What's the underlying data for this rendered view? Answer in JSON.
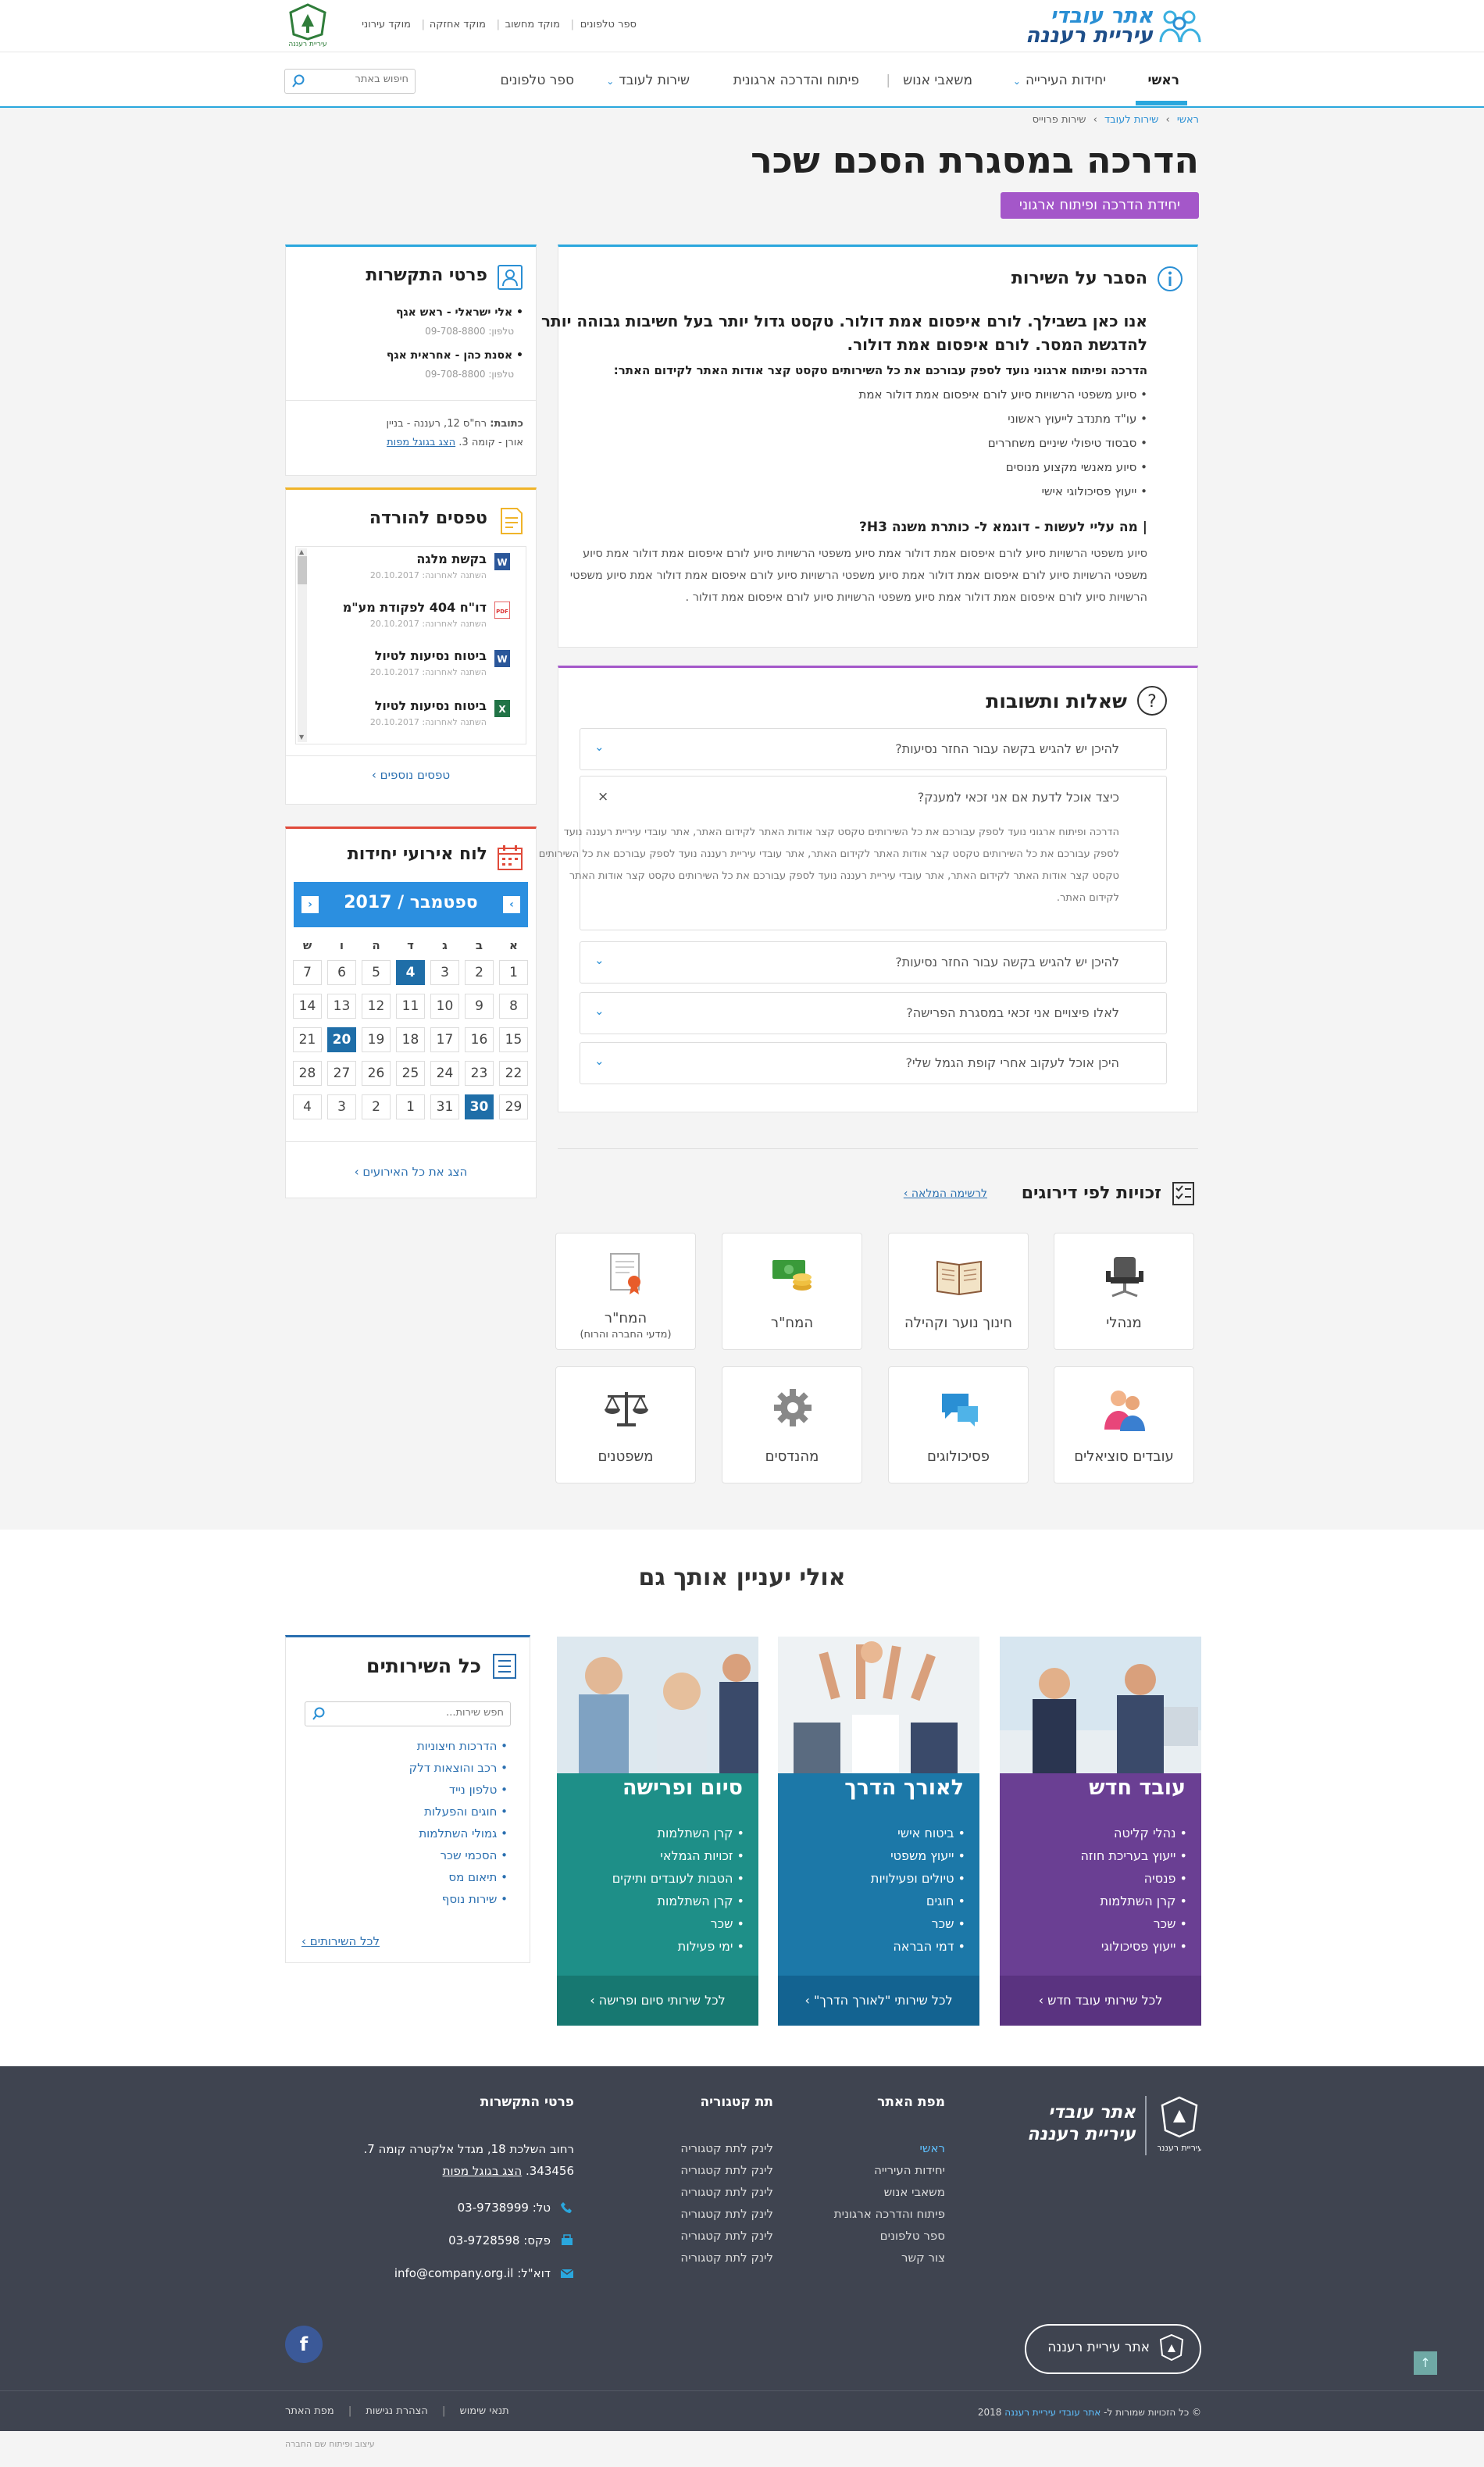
{
  "header": {
    "logo_line1": "אתר עובדי",
    "logo_line2": "עיריית רעננה",
    "city_logo_text": "עיריית רעננה",
    "util_links": [
      "ספר טלפונים",
      "מוקד מחשוב",
      "מוקד אחזקה",
      "מוקד עירוני"
    ],
    "search_placeholder": "חיפוש באתר"
  },
  "nav": {
    "items": [
      {
        "label": "ראשי",
        "active": true,
        "dropdown": false
      },
      {
        "label": "יחידות העירייה",
        "active": false,
        "dropdown": true
      },
      {
        "label": "משאבי אנוש",
        "active": false,
        "dropdown": false
      },
      {
        "label": "פיתוח והדרכה ארגונית",
        "active": false,
        "dropdown": false
      },
      {
        "label": "שירות לעובד",
        "active": false,
        "dropdown": true
      },
      {
        "label": "ספר טלפונים",
        "active": false,
        "dropdown": false
      }
    ]
  },
  "breadcrumb": [
    "ראשי",
    "שירות לעובד",
    "שירות פרוייס"
  ],
  "page": {
    "title": "הדרכה במסגרת הסכם שכר",
    "unit_badge": "יחידת הדרכה ופיתוח ארגוני"
  },
  "explain": {
    "heading": "הסבר על השירות",
    "lead": "אנו כאן בשבילך. לורם איפסום אמת דולור. טקסט גדול יותר בעל חשיבות גבוהה יותר להדגשת המסר. לורם איפסום אמת דולור.",
    "lead_line1": "אנו כאן בשבילך. לורם איפסום אמת דולור. טקסט גדול יותר בעל חשיבות גבוהה יותר",
    "lead_line2": "להדגשת המסר. לורם איפסום אמת דולור.",
    "intro": "הדרכה ופיתוח ארגוני נועד לספק עבורכם את כל השירותים טקסט קצר אודות האתר לקידום האתר:",
    "bullets": [
      "סיוע משפטי הרשויות סיוע לורם איפסום אמת דולור אמת",
      "עו\"ד מתנדב לייעוץ ראשוני",
      "סבסוד טיפולי שיניים משחררים",
      "סיוע מאנשי מקצוע מנוסים",
      "ייעוץ פסיכולוגי אישי"
    ],
    "h3": "| מה עליי לעשות - דוגמא ל- כותרת משנה H3?",
    "body_lines": [
      "סיוע משפטי הרשויות סיוע לורם איפסום אמת דולור אמת סיוע משפטי הרשויות סיוע לורם איפסום אמת דולור אמת סיוע",
      "משפטי הרשויות סיוע לורם איפסום אמת דולור אמת סיוע משפטי הרשויות סיוע לורם איפסום אמת דולור אמת סיוע משפטי",
      "הרשויות סיוע לורם איפסום אמת דולור אמת סיוע משפטי הרשויות סיוע לורם איפסום אמת דולור ."
    ]
  },
  "faq": {
    "heading": "שאלות ותשובות",
    "items": [
      {
        "q": "להיכן יש להגיש בקשה עבור החזר נסיעות?",
        "open": false
      },
      {
        "q": "כיצד אוכל לדעת אם אני זכאי למענק?",
        "open": true
      },
      {
        "q": "להיכן יש להגיש בקשה עבור החזר נסיעות?",
        "open": false
      },
      {
        "q": "לאלו פיצויים אני זכאי במסגרת הפרישה?",
        "open": false
      },
      {
        "q": "היכן אוכל לעקוב אחרי קופת הגמל שלי?",
        "open": false
      }
    ],
    "open_answer_lines": [
      "הדרכה ופיתוח ארגוני נועד לספק עבורכם את כל השירותים טקסט קצר אודות האתר לקידום האתר, אתר עובדי עיריית רעננה נועד",
      "לספק עבורכם את כל השירותים טקסט קצר אודות האתר לקידום האתר, אתר עובדי עיריית רעננה נועד לספק עבורכם את כל השירותים",
      "טקסט קצר אודות האתר לקידום האתר, אתר עובדי עיריית רעננה נועד לספק עבורכם את כל השירותים טקסט קצר אודות האתר",
      "לקידום האתר."
    ]
  },
  "ranks": {
    "heading": "זכויות לפי דירוגים",
    "full_list": "לרשימה המלאה ›",
    "tiles": [
      {
        "label": "מנהלי",
        "sub": "",
        "icon": "chair-icon"
      },
      {
        "label": "חינוך נוער וקהילה",
        "sub": "",
        "icon": "book-icon"
      },
      {
        "label": "המח\"ר",
        "sub": "",
        "icon": "money-icon"
      },
      {
        "label": "המח\"ר",
        "sub": "(מדעי החברה והרוח)",
        "icon": "certificate-icon"
      },
      {
        "label": "עובדים סוציאלים",
        "sub": "",
        "icon": "people-icon"
      },
      {
        "label": "פסיכולוגים",
        "sub": "",
        "icon": "chat-icon"
      },
      {
        "label": "מהנדסים",
        "sub": "",
        "icon": "gear-icon"
      },
      {
        "label": "משפטנים",
        "sub": "",
        "icon": "scales-icon"
      }
    ]
  },
  "contact": {
    "heading": "פרטי התקשרות",
    "people": [
      {
        "name": "אלי ישראלי - ראש אגף",
        "phone": "טלפון: 09-708-8800"
      },
      {
        "name": "אסנת כהן - אחראית אגף",
        "phone": "טלפון: 09-708-8800"
      }
    ],
    "address_label": "כתובת:",
    "address_line1": "רח\"ס 12, רעננה - בניין",
    "address_line2": "אורן - קומה 3.",
    "map_link": "הצג בגוגל מפות"
  },
  "forms": {
    "heading": "טפסים להורדה",
    "items": [
      {
        "title": "בקשת מלגה",
        "date": "השתנה לאחרונה: 20.10.2017",
        "type": "word"
      },
      {
        "title": "דו\"ח 404 לפקודת מע\"מ",
        "date": "השתנה לאחרונה: 20.10.2017",
        "type": "pdf"
      },
      {
        "title": "ביטוח נסיעות לטיול",
        "date": "השתנה לאחרונה: 20.10.2017",
        "type": "word"
      },
      {
        "title": "ביטוח נסיעות לטיול",
        "date": "השתנה לאחרונה: 20.10.2017",
        "type": "excel"
      }
    ],
    "more": "טפסים נוספים ›"
  },
  "calendar": {
    "heading": "לוח אירועי יחידות",
    "month_label": "ספטמבר / 2017",
    "weekdays": [
      "א",
      "ב",
      "ג",
      "ד",
      "ה",
      "ו",
      "ש"
    ],
    "weeks": [
      [
        1,
        2,
        3,
        4,
        5,
        6,
        7
      ],
      [
        8,
        9,
        10,
        11,
        12,
        13,
        14
      ],
      [
        15,
        16,
        17,
        18,
        19,
        20,
        21
      ],
      [
        22,
        23,
        24,
        25,
        26,
        27,
        28
      ],
      [
        29,
        30,
        31,
        1,
        2,
        3,
        4
      ]
    ],
    "selected": [
      [
        0,
        3
      ],
      [
        2,
        5
      ],
      [
        4,
        1
      ]
    ],
    "all_events": "הצג את כל האירועים ›"
  },
  "maybe": {
    "heading": "אולי יעניין אותך גם",
    "cards": [
      {
        "title": "עובד חדש",
        "items": [
          "נהלי קליטה",
          "ייעוץ בעריכת חוזה",
          "פנסיה",
          "קרן השתלמות",
          "שכר",
          "ייעוץ פסיכולוגי"
        ],
        "footer": "לכל שירותי עובד חדש ›",
        "color": "#6a3f93"
      },
      {
        "title": "לאורך הדרך",
        "items": [
          "ביטוח אישי",
          "ייעוץ משפטי",
          "טיולים ופעילויות",
          "חוגים",
          "שכר",
          "דמי הבראה"
        ],
        "footer": "לכל שירותי \"לאורך הדרך\" ›",
        "color": "#1c78a8"
      },
      {
        "title": "סיום ופרישה",
        "items": [
          "קרן השתלמות",
          "זכויות הגמלאי",
          "הטבות לעובדים ותיקים",
          "קרן השתלמות",
          "שכר",
          "ימי פעילות"
        ],
        "footer": "לכל שירותי סיום ופרישה ›",
        "color": "#1e8f88"
      }
    ]
  },
  "all_services": {
    "heading": "כל השירותים",
    "search_placeholder": "חפש שירות...",
    "links": [
      "הדרכות חיצוניות",
      "רכב והוצאות דלק",
      "טלפון נייד",
      "חוגים והפעלות",
      "גמולי השתלמות",
      "הסכמי שכר",
      "תיאום מס",
      "שירות נוסף"
    ],
    "all_link": "לכל השירותים ›"
  },
  "footer": {
    "logo_line1": "אתר עובדי",
    "logo_line2": "עיריית רעננה",
    "sitemap_heading": "מפת האתר",
    "sitemap": [
      "ראשי",
      "יחידות העירייה",
      "משאבי אנוש",
      "פיתוח והדרכה ארגונית",
      "ספר טלפונים",
      "צור קשר"
    ],
    "subcat_heading": "תת קטגוריה",
    "subcat": [
      "לינק לתת קטגוריה",
      "לינק לתת קטגוריה",
      "לינק לתת קטגוריה",
      "לינק לתת קטגוריה",
      "לינק לתת קטגוריה",
      "לינק לתת קטגוריה"
    ],
    "contact_heading": "פרטי התקשרות",
    "address_line1": "רחוב השלכת 18, מגדל אלקטרה קומה 7.",
    "address_line2": "343456.",
    "map_link": "הצג בגוגל מפות",
    "tel": "טל: 03-9738999",
    "fax": "פקס: 03-9728598",
    "email": "דוא\"ל: info@company.org.il",
    "pill_text": "אתר עיריית רעננה",
    "copyright_prefix": "© כל הזכויות שמורות ל- ",
    "copyright_link": "אתר עובדי עיריית רעננה",
    "copyright_year": " 2018",
    "bottom_links": [
      "תנאי שימוש",
      "הצהרת נגישות",
      "מפת האתר"
    ],
    "credit": "עיצוב ופיתוח שם החברה"
  },
  "colors": {
    "accent": "#2aa7dd",
    "badge": "#a457c9",
    "calendar": "#2b8fe0",
    "footer": "#3f4450"
  }
}
